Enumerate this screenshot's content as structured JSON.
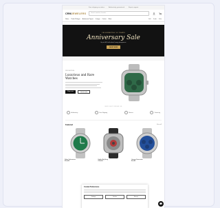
{
  "top_bar": {
    "items": [
      "Free shipping on orders",
      "Authenticity guaranteed",
      "Expert support"
    ]
  },
  "header": {
    "logo_main": "CRM",
    "logo_accent": "JEWELERS",
    "search_placeholder": "Search watches, brands..."
  },
  "nav": {
    "items": [
      "Rolex",
      "Patek Philippe",
      "Audemars Piguet",
      "Omega",
      "Cartier",
      "More"
    ],
    "links": [
      "Sell",
      "Trade",
      "Sale"
    ]
  },
  "hero": {
    "eyebrow": "CELEBRATING 50 YEARS",
    "title": "Anniversary Sale",
    "subtitle": "Up to 40% off select luxury timepieces",
    "button": "SHOP NOW"
  },
  "feature": {
    "eyebrow": "NEW ARRIVAL",
    "title": "Luxurious and Rare Watches",
    "button_primary": "Shop now",
    "button_secondary": "Learn more"
  },
  "divider_title": "WHY BUY FROM US",
  "usp": [
    "Authenticity",
    "Free Shipping",
    "Returns",
    "Financing"
  ],
  "section": {
    "title": "Featured",
    "more": "View all"
  },
  "products": [
    {
      "name": "Rolex Submariner",
      "price": "$14,950",
      "dial_color": "#1f7a4a"
    },
    {
      "name": "Hublot Big Bang",
      "price": "$18,500",
      "dial_color": "#8a8a8a"
    },
    {
      "name": "Omega Seamaster",
      "price": "$6,200",
      "dial_color": "#234f9a"
    }
  ],
  "cookie": {
    "title": "Cookie Preferences",
    "accept": "Accept",
    "decline": "Decline",
    "settings": "Settings"
  },
  "colors": {
    "accent": "#c9a356",
    "hero_bg": "#121212",
    "page_bg": "#eef0f9"
  }
}
